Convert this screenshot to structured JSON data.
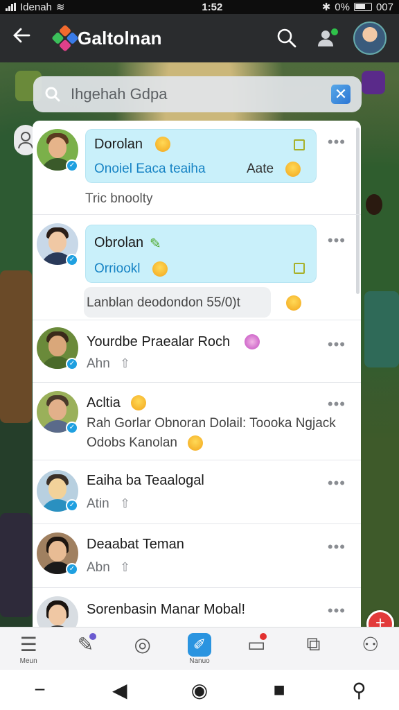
{
  "status_bar": {
    "carrier": "Idenah",
    "time": "1:52",
    "battery": "0%",
    "extra": "007"
  },
  "header": {
    "title": "Galtolnan"
  },
  "search": {
    "placeholder": "Ihgehah Gdpa"
  },
  "chats": [
    {
      "name": "Dorolan",
      "preview_link": "Onoiel Eaca teaiha",
      "preview_right": "Aate",
      "note": "Tric bnoolty",
      "highlighted": true
    },
    {
      "name": "Obrolan",
      "preview_link": "Orriookl",
      "note": "Lanblan deodondon  55/0)t",
      "highlighted": true
    },
    {
      "name": "Yourdbe Praealar Roch",
      "sub": "Ahn"
    },
    {
      "name": "Acltia",
      "sub_line1": "Rah Gorlar Obnoran Dolail: Toooka Ngjack",
      "sub_line2": "Odobs Kanolan"
    },
    {
      "name": "Eaiha ba Teaalogal",
      "sub": "Atin"
    },
    {
      "name": "Deaabat Teman",
      "sub": "Abn"
    },
    {
      "name": "Sorenbasin Manar Mobal!"
    }
  ],
  "bottom_nav": {
    "items": [
      "Meun",
      "",
      "",
      "Nanuo",
      "",
      "",
      ""
    ]
  },
  "icons": {
    "back": "arrow-left-icon",
    "search": "search-icon",
    "contacts": "add-contact-icon",
    "menu": "menu-icon",
    "edit": "edit-icon",
    "camera": "camera-icon",
    "chat": "chat-icon",
    "profile": "profile-icon"
  },
  "colors": {
    "accent": "#2a94e0",
    "bubble": "#c9f0fa",
    "badge": "#1fa0e0",
    "alert": "#e23a3a"
  }
}
